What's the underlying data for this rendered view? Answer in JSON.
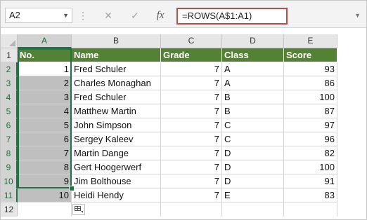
{
  "formula_bar": {
    "name_box": "A2",
    "cancel_icon": "✕",
    "enter_icon": "✓",
    "fx_label": "fx",
    "formula": "=ROWS(A$1:A1)"
  },
  "columns": [
    "A",
    "B",
    "C",
    "D",
    "E"
  ],
  "rows": [
    "1",
    "2",
    "3",
    "4",
    "5",
    "6",
    "7",
    "8",
    "9",
    "10",
    "11",
    "12"
  ],
  "table": {
    "headers": [
      "No.",
      "Name",
      "Grade",
      "Class",
      "Score"
    ],
    "data": [
      [
        "1",
        "Fred Schuler",
        "7",
        "A",
        "93"
      ],
      [
        "2",
        "Charles Monaghan",
        "7",
        "A",
        "86"
      ],
      [
        "3",
        "Fred Schuler",
        "7",
        "B",
        "100"
      ],
      [
        "4",
        "Matthew Martin",
        "7",
        "B",
        "87"
      ],
      [
        "5",
        "John Simpson",
        "7",
        "C",
        "97"
      ],
      [
        "6",
        "Sergey Kaleev",
        "7",
        "C",
        "96"
      ],
      [
        "7",
        "Martin Dange",
        "7",
        "D",
        "82"
      ],
      [
        "8",
        "Gert Hoogerwerf",
        "7",
        "D",
        "100"
      ],
      [
        "9",
        "Jim Bolthouse",
        "7",
        "D",
        "91"
      ],
      [
        "10",
        "Heidi Hendy",
        "7",
        "E",
        "83"
      ]
    ]
  },
  "colors": {
    "header_fill": "#548235",
    "selection_border": "#217346",
    "formula_highlight": "#b84a4a"
  },
  "icons": {
    "autofill_options": "autofill-options-icon"
  }
}
